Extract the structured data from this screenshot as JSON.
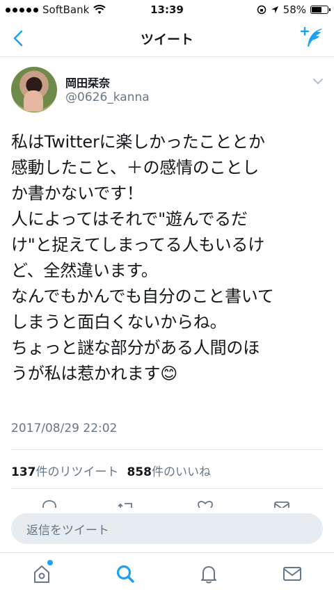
{
  "status_bar": {
    "carrier": "SoftBank",
    "time": "13:39",
    "battery": "58%",
    "battery_level": 0.58
  },
  "nav": {
    "title": "ツイート",
    "back_icon": "chevron-left-icon",
    "compose_icon": "compose-feather-icon"
  },
  "tweet": {
    "display_name": "岡田栞奈",
    "handle": "@0626_kanna",
    "text": "私はTwitterに楽しかったこととか\n感動したこと、＋の感情のことし\nか書かないです！\n人によってはそれで\"遊んでるだ\nけ\"と捉えてしまってる人もいるけ\nど、全然違います。\nなんでもかんでも自分のこと書いて\nしまうと面白くないからね。\nちょっと謎な部分がある人間のほ\nうが私は惹かれます😊",
    "timestamp": "2017/08/29 22:02",
    "retweet_count": "137",
    "retweet_label": "件のリツイート",
    "like_count": "858",
    "like_label": "件のいいね"
  },
  "reply": {
    "placeholder": "返信をツイート"
  },
  "tabs": [
    {
      "icon": "home-icon"
    },
    {
      "icon": "search-icon"
    },
    {
      "icon": "notifications-bell-icon"
    },
    {
      "icon": "messages-envelope-icon"
    }
  ],
  "colors": {
    "accent": "#1da1f2",
    "text": "#14171a",
    "secondary": "#657786",
    "divider": "#e1e8ed"
  }
}
